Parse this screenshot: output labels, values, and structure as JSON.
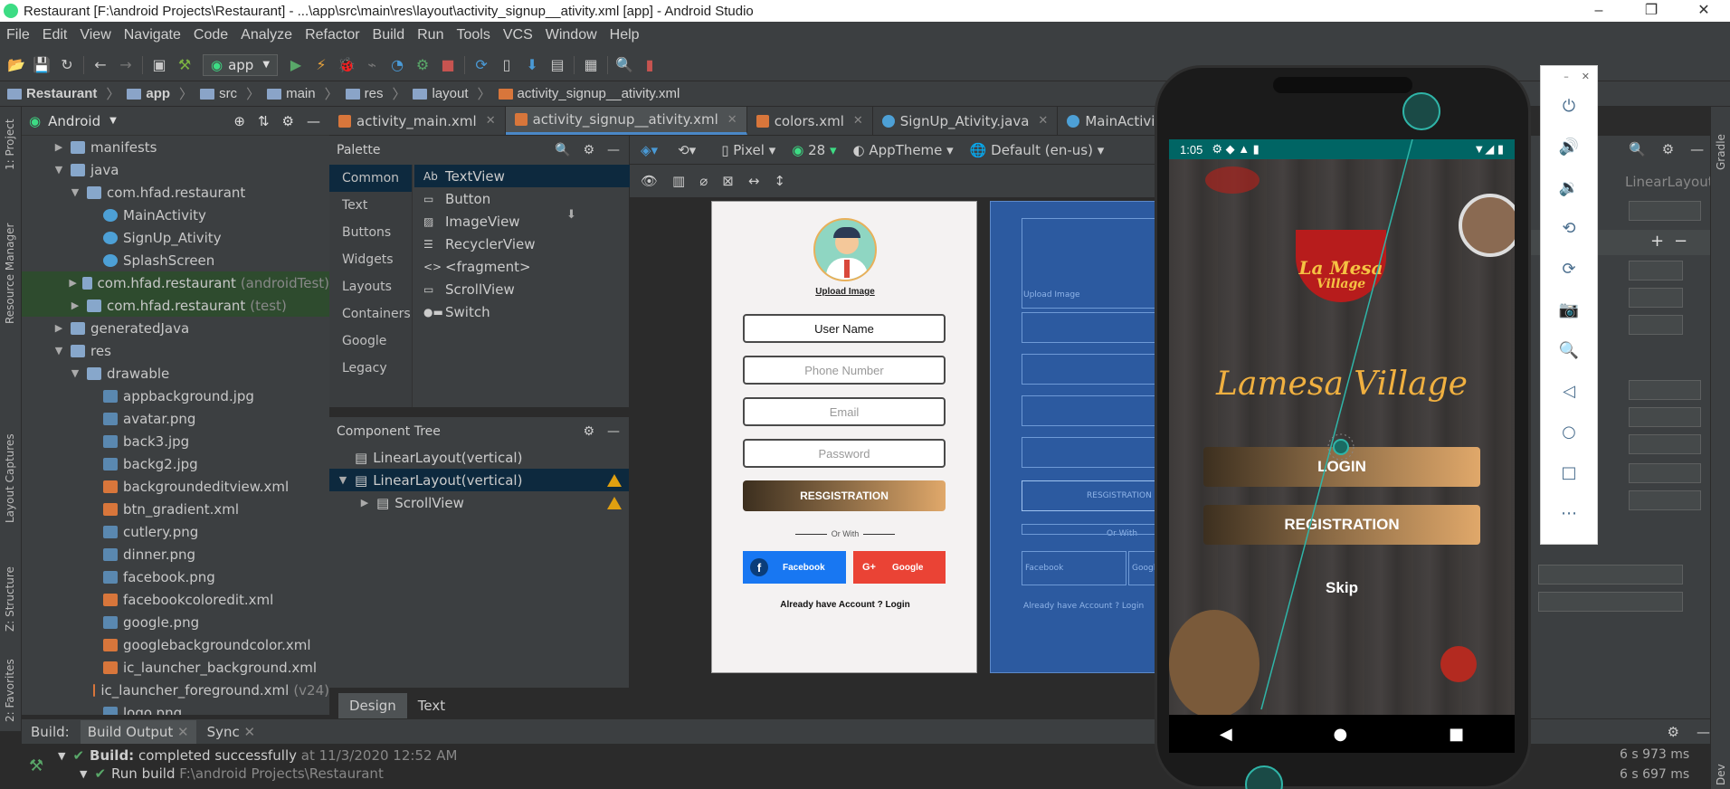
{
  "window": {
    "title": "Restaurant [F:\\android Projects\\Restaurant] - ...\\app\\src\\main\\res\\layout\\activity_signup__ativity.xml [app] - Android Studio",
    "min": "–",
    "max": "❐",
    "close": "✕"
  },
  "menu": [
    "File",
    "Edit",
    "View",
    "Navigate",
    "Code",
    "Analyze",
    "Refactor",
    "Build",
    "Run",
    "Tools",
    "VCS",
    "Window",
    "Help"
  ],
  "toolbar": {
    "config": "app"
  },
  "breadcrumb": [
    "Restaurant",
    "app",
    "src",
    "main",
    "res",
    "layout",
    "activity_signup__ativity.xml"
  ],
  "project": {
    "view": "Android",
    "tree": [
      {
        "label": "manifests",
        "muted": "",
        "type": "folder",
        "depth": 1,
        "arrow": "▶"
      },
      {
        "label": "java",
        "muted": "",
        "type": "folder",
        "depth": 1,
        "arrow": "▼"
      },
      {
        "label": "com.hfad.restaurant",
        "muted": "",
        "type": "folder",
        "depth": 2,
        "arrow": "▼"
      },
      {
        "label": "MainActivity",
        "muted": "",
        "type": "java",
        "depth": 3,
        "arrow": ""
      },
      {
        "label": "SignUp_Ativity",
        "muted": "",
        "type": "java",
        "depth": 3,
        "arrow": ""
      },
      {
        "label": "SplashScreen",
        "muted": "",
        "type": "java",
        "depth": 3,
        "arrow": ""
      },
      {
        "label": "com.hfad.restaurant",
        "muted": "(androidTest)",
        "type": "folder",
        "depth": 2,
        "arrow": "▶",
        "sel": true
      },
      {
        "label": "com.hfad.restaurant",
        "muted": "(test)",
        "type": "folder",
        "depth": 2,
        "arrow": "▶",
        "sel": true
      },
      {
        "label": "generatedJava",
        "muted": "",
        "type": "folder",
        "depth": 1,
        "arrow": "▶"
      },
      {
        "label": "res",
        "muted": "",
        "type": "folder",
        "depth": 1,
        "arrow": "▼"
      },
      {
        "label": "drawable",
        "muted": "",
        "type": "folder",
        "depth": 2,
        "arrow": "▼"
      },
      {
        "label": "appbackground.jpg",
        "muted": "",
        "type": "img",
        "depth": 3,
        "arrow": ""
      },
      {
        "label": "avatar.png",
        "muted": "",
        "type": "img",
        "depth": 3,
        "arrow": ""
      },
      {
        "label": "back3.jpg",
        "muted": "",
        "type": "img",
        "depth": 3,
        "arrow": ""
      },
      {
        "label": "backg2.jpg",
        "muted": "",
        "type": "img",
        "depth": 3,
        "arrow": ""
      },
      {
        "label": "backgroundeditview.xml",
        "muted": "",
        "type": "xml",
        "depth": 3,
        "arrow": ""
      },
      {
        "label": "btn_gradient.xml",
        "muted": "",
        "type": "xml",
        "depth": 3,
        "arrow": ""
      },
      {
        "label": "cutlery.png",
        "muted": "",
        "type": "img",
        "depth": 3,
        "arrow": ""
      },
      {
        "label": "dinner.png",
        "muted": "",
        "type": "img",
        "depth": 3,
        "arrow": ""
      },
      {
        "label": "facebook.png",
        "muted": "",
        "type": "img",
        "depth": 3,
        "arrow": ""
      },
      {
        "label": "facebookcoloredit.xml",
        "muted": "",
        "type": "xml",
        "depth": 3,
        "arrow": ""
      },
      {
        "label": "google.png",
        "muted": "",
        "type": "img",
        "depth": 3,
        "arrow": ""
      },
      {
        "label": "googlebackgroundcolor.xml",
        "muted": "",
        "type": "xml",
        "depth": 3,
        "arrow": ""
      },
      {
        "label": "ic_launcher_background.xml",
        "muted": "",
        "type": "xml",
        "depth": 3,
        "arrow": ""
      },
      {
        "label": "ic_launcher_foreground.xml",
        "muted": "(v24)",
        "type": "xml",
        "depth": 3,
        "arrow": ""
      },
      {
        "label": "logo.png",
        "muted": "",
        "type": "img",
        "depth": 3,
        "arrow": ""
      }
    ]
  },
  "left_strip": {
    "project": "1: Project",
    "resource": "Resource Manager",
    "captures": "Layout Captures",
    "structure": "Z: Structure",
    "favorites": "2: Favorites"
  },
  "editor_tabs": [
    {
      "label": "activity_main.xml",
      "icon": "xml",
      "active": false
    },
    {
      "label": "activity_signup__ativity.xml",
      "icon": "xml",
      "active": true
    },
    {
      "label": "colors.xml",
      "icon": "xml",
      "active": false
    },
    {
      "label": "SignUp_Ativity.java",
      "icon": "java",
      "active": false
    },
    {
      "label": "MainActivity.java",
      "icon": "java",
      "active": false
    }
  ],
  "palette": {
    "title": "Palette",
    "categories": [
      "Common",
      "Text",
      "Buttons",
      "Widgets",
      "Layouts",
      "Containers",
      "Google",
      "Legacy"
    ],
    "items": [
      {
        "icon": "Ab",
        "label": "TextView"
      },
      {
        "icon": "▭",
        "label": "Button"
      },
      {
        "icon": "▨",
        "label": "ImageView"
      },
      {
        "icon": "☰",
        "label": "RecyclerView"
      },
      {
        "icon": "<>",
        "label": "<fragment>"
      },
      {
        "icon": "▭",
        "label": "ScrollView"
      },
      {
        "icon": "●▬",
        "label": "Switch"
      }
    ]
  },
  "component_tree": {
    "title": "Component Tree",
    "rows": [
      {
        "label": "LinearLayout(vertical)",
        "depth": 0,
        "arrow": "",
        "warn": false,
        "sel": false
      },
      {
        "label": "LinearLayout(vertical)",
        "depth": 0,
        "arrow": "▼",
        "warn": true,
        "sel": true
      },
      {
        "label": "ScrollView",
        "depth": 1,
        "arrow": "▶",
        "warn": true,
        "sel": false
      }
    ]
  },
  "design_toolbar": {
    "device": "Pixel",
    "api": "28",
    "theme": "AppTheme",
    "locale": "Default (en-us)"
  },
  "design_preview": {
    "upload": "Upload Image",
    "fields": [
      "User Name",
      "Phone Number",
      "Email",
      "Password"
    ],
    "register": "RESGISTRATION",
    "or_with": "Or With",
    "facebook": "Facebook",
    "google": "Google",
    "login_hint": "Already have Account ? Login"
  },
  "blueprint": {
    "upload": "Upload Image",
    "register": "RESGISTRATION",
    "or_with": "Or With",
    "facebook": "Facebook",
    "google": "Googl",
    "login_hint": "Already have Account ? Login"
  },
  "view_tabs": [
    "Design",
    "Text"
  ],
  "right_panel": {
    "title": "LinearLayout"
  },
  "right_strip": {
    "gradle": "Gradle",
    "device": "Dev"
  },
  "build": {
    "tabs": [
      "Build:",
      "Build Output",
      "Sync"
    ],
    "status_label": "Build:",
    "status": "completed successfully",
    "time": "at 11/3/2020 12:52 AM",
    "run_label": "Run build",
    "run_path": "F:\\android Projects\\Restaurant",
    "dur1": "6 s 973 ms",
    "dur2": "6 s 697 ms"
  },
  "phone": {
    "time": "1:05",
    "logo_line1": "La Mesa",
    "logo_line2": "Village",
    "app_title": "Lamesa Village",
    "login": "LOGIN",
    "registration": "REGISTRATION",
    "skip": "Skip",
    "nav": [
      "◀",
      "●",
      "■"
    ]
  },
  "emulator_controls": [
    "power-icon",
    "volume-up-icon",
    "volume-down-icon",
    "rotate-left-icon",
    "rotate-right-icon",
    "camera-icon",
    "zoom-icon",
    "back-icon",
    "home-icon",
    "overview-icon",
    "more-icon"
  ],
  "emulator_glyphs": {
    "power-icon": "⏻",
    "volume-up-icon": "🔊",
    "volume-down-icon": "🔉",
    "rotate-left-icon": "⟲",
    "rotate-right-icon": "⟳",
    "camera-icon": "📷",
    "zoom-icon": "🔍",
    "back-icon": "◁",
    "home-icon": "○",
    "overview-icon": "□",
    "more-icon": "⋯"
  }
}
